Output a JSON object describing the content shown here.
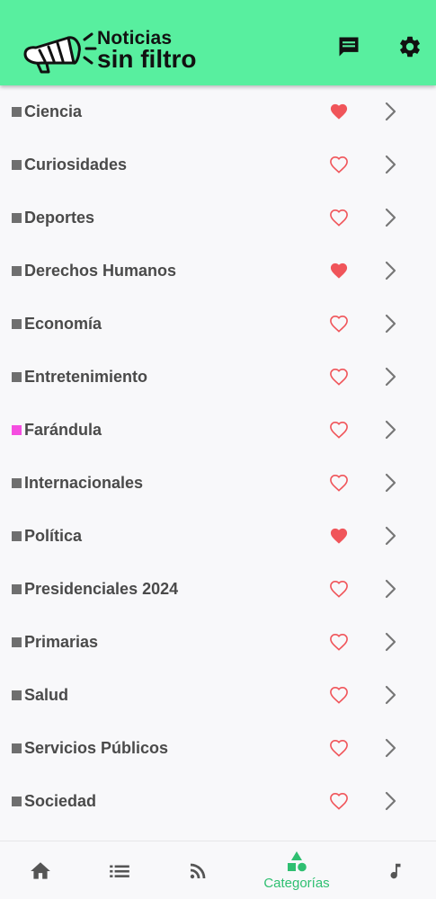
{
  "header": {
    "title_line1": "Noticias",
    "title_line2": "sin filtro",
    "bg_color": "#58ef9f",
    "chat_icon": "chat-icon",
    "settings_icon": "gear-icon"
  },
  "categories": [
    {
      "label": "Ciencia",
      "favorite": true,
      "square_color": "#6f6f6f"
    },
    {
      "label": "Curiosidades",
      "favorite": false,
      "square_color": "#6f6f6f"
    },
    {
      "label": "Deportes",
      "favorite": false,
      "square_color": "#6f6f6f"
    },
    {
      "label": "Derechos Humanos",
      "favorite": true,
      "square_color": "#6f6f6f"
    },
    {
      "label": "Economía",
      "favorite": false,
      "square_color": "#6f6f6f"
    },
    {
      "label": "Entretenimiento",
      "favorite": false,
      "square_color": "#6f6f6f"
    },
    {
      "label": "Farándula",
      "favorite": false,
      "square_color": "#f54ee0"
    },
    {
      "label": "Internacionales",
      "favorite": false,
      "square_color": "#6f6f6f"
    },
    {
      "label": "Política",
      "favorite": true,
      "square_color": "#6f6f6f"
    },
    {
      "label": "Presidenciales 2024",
      "favorite": false,
      "square_color": "#6f6f6f"
    },
    {
      "label": "Primarias",
      "favorite": false,
      "square_color": "#6f6f6f"
    },
    {
      "label": "Salud",
      "favorite": false,
      "square_color": "#6f6f6f"
    },
    {
      "label": "Servicios Públicos",
      "favorite": false,
      "square_color": "#6f6f6f"
    },
    {
      "label": "Sociedad",
      "favorite": false,
      "square_color": "#6f6f6f"
    }
  ],
  "colors": {
    "heart": "#f0555a",
    "active_nav": "#2fbf71",
    "nav_icon": "#555555"
  },
  "bottom_nav": {
    "items": [
      {
        "icon": "home-icon"
      },
      {
        "icon": "list-icon"
      },
      {
        "icon": "rss-icon"
      },
      {
        "icon": "shapes-icon",
        "label": "Categorías",
        "active": true
      },
      {
        "icon": "music-note-icon"
      }
    ]
  }
}
